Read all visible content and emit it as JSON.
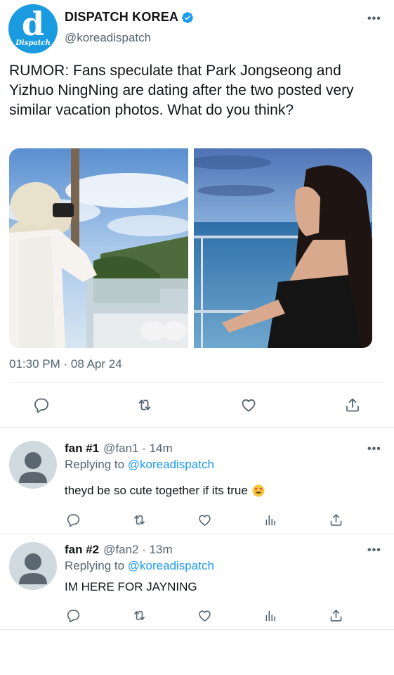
{
  "account": {
    "avatar_letter": "d",
    "avatar_word": "Dispatch",
    "name": "DISPATCH KOREA",
    "handle": "@koreadispatch"
  },
  "tweet": {
    "text": "RUMOR: Fans speculate that Park Jongseong and Yizhuo NingNing are dating after the two posted very similar vacation photos. What do you think?",
    "timestamp": "01:30 PM · 08 Apr 24"
  },
  "replies": [
    {
      "name": "fan #1",
      "handle": "@fan1 · 14m",
      "replying_label": "Replying to",
      "replying_to": "@koreadispatch",
      "text": "theyd be so cute together if its true",
      "emoji": "heart-eyes"
    },
    {
      "name": "fan #2",
      "handle": "@fan2 · 13m",
      "replying_label": "Replying to",
      "replying_to": "@koreadispatch",
      "text": "IM HERE FOR JAYNING"
    }
  ],
  "colors": {
    "accent": "#1d9bf0",
    "secondary_text": "#536471",
    "divider": "#e3e7ea"
  }
}
